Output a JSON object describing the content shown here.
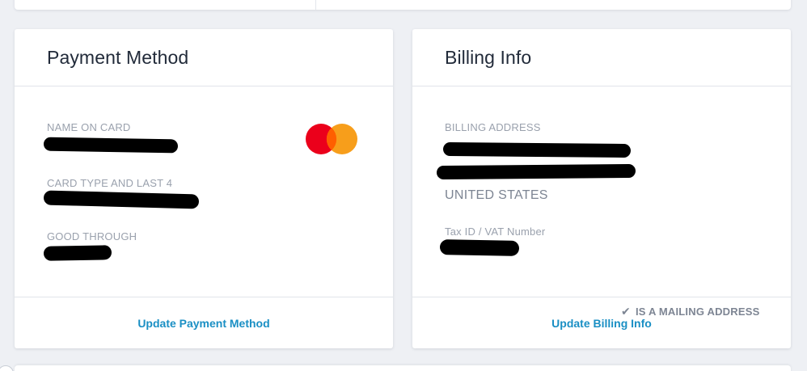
{
  "payment": {
    "title": "Payment Method",
    "name_label": "NAME ON CARD",
    "card_type_label": "CARD TYPE AND LAST 4",
    "good_through_label": "GOOD THROUGH",
    "card_brand_icon": "mastercard-icon",
    "update_link": "Update Payment Method"
  },
  "billing": {
    "title": "Billing Info",
    "address_label": "BILLING ADDRESS",
    "country": "UNITED STATES",
    "tax_label": "Tax ID / VAT Number",
    "mailing_label": "IS A MAILING ADDRESS",
    "update_link": "Update Billing Info"
  },
  "colors": {
    "link": "#1a8fc4",
    "mastercard_red": "#eb001b",
    "mastercard_orange": "#f79e1b"
  }
}
